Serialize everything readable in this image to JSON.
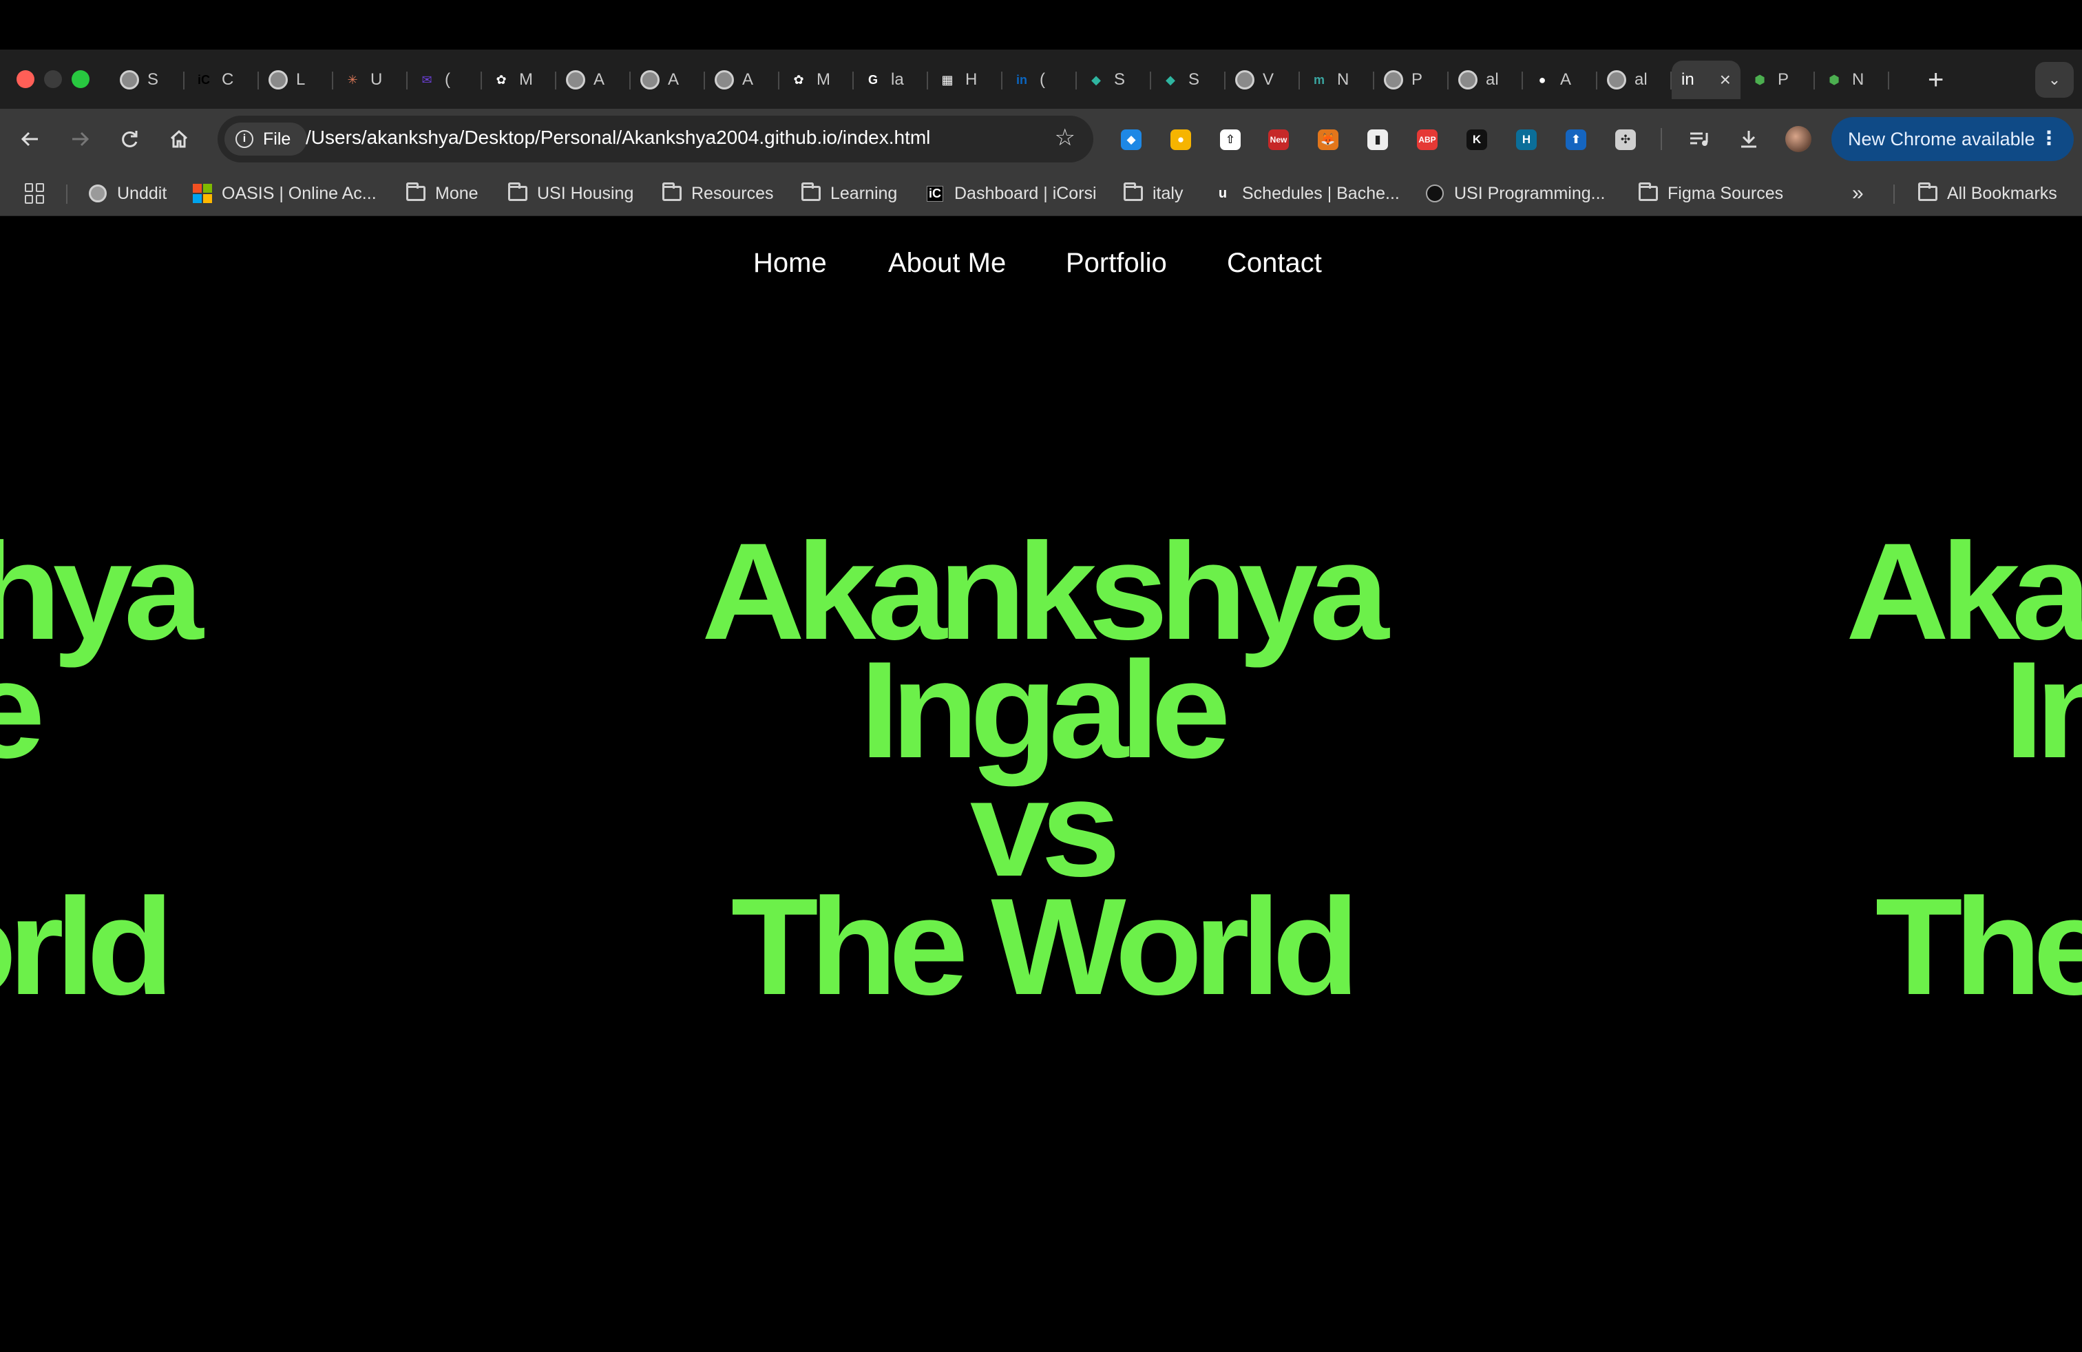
{
  "browser": {
    "tabs": [
      {
        "label": "S",
        "icon": "globe-icon",
        "color": "#888888",
        "glyph": ""
      },
      {
        "label": "C",
        "icon": "icorsi-icon",
        "color": "#000000",
        "glyph": "iC"
      },
      {
        "label": "L",
        "icon": "globe-icon",
        "color": "#888888",
        "glyph": ""
      },
      {
        "label": "U",
        "icon": "claude-icon",
        "color": "#d97757",
        "glyph": "✳"
      },
      {
        "label": "(",
        "icon": "mail-icon",
        "color": "#6b3fd6",
        "glyph": "✉"
      },
      {
        "label": "M",
        "icon": "chatgpt-icon",
        "color": "#ffffff",
        "glyph": "✿"
      },
      {
        "label": "A",
        "icon": "globe-icon",
        "color": "#888888",
        "glyph": ""
      },
      {
        "label": "A",
        "icon": "globe-icon",
        "color": "#888888",
        "glyph": ""
      },
      {
        "label": "A",
        "icon": "globe-icon",
        "color": "#888888",
        "glyph": ""
      },
      {
        "label": "M",
        "icon": "chatgpt-icon",
        "color": "#ffffff",
        "glyph": "✿"
      },
      {
        "label": "la",
        "icon": "google-icon",
        "color": "#ffffff",
        "glyph": "G"
      },
      {
        "label": "H",
        "icon": "notion-icon",
        "color": "#ffffff",
        "glyph": "▦"
      },
      {
        "label": "(",
        "icon": "linkedin-icon",
        "color": "#0a66c2",
        "glyph": "in"
      },
      {
        "label": "S",
        "icon": "diamond-icon",
        "color": "#2fb5a0",
        "glyph": "◆"
      },
      {
        "label": "S",
        "icon": "diamond-icon",
        "color": "#2fb5a0",
        "glyph": "◆"
      },
      {
        "label": "V",
        "icon": "globe-icon",
        "color": "#888888",
        "glyph": ""
      },
      {
        "label": "N",
        "icon": "m-icon",
        "color": "#3aa5a0",
        "glyph": "m"
      },
      {
        "label": "P",
        "icon": "globe-icon",
        "color": "#888888",
        "glyph": ""
      },
      {
        "label": "al",
        "icon": "globe-icon",
        "color": "#888888",
        "glyph": ""
      },
      {
        "label": "A",
        "icon": "github-icon",
        "color": "#ffffff",
        "glyph": "●"
      },
      {
        "label": "al",
        "icon": "globe-icon",
        "color": "#888888",
        "glyph": ""
      },
      {
        "label": "in",
        "icon": "",
        "color": "",
        "glyph": "",
        "active": true
      },
      {
        "label": "P",
        "icon": "cube-icon",
        "color": "#4caf50",
        "glyph": "⬢"
      },
      {
        "label": "N",
        "icon": "cube-icon",
        "color": "#4caf50",
        "glyph": "⬢"
      }
    ],
    "new_tab": "+",
    "tab_search": "⌄",
    "omnibox": {
      "chip_label": "File",
      "url": "/Users/akankshya/Desktop/Personal/Akankshya2004.github.io/index.html"
    },
    "extensions": [
      {
        "name": "gem-extension-icon",
        "color": "#1e88e5",
        "glyph": "◆"
      },
      {
        "name": "keep-extension-icon",
        "color": "#f6b400",
        "glyph": "●"
      },
      {
        "name": "upload-extension-icon",
        "color": "#ffffff",
        "glyph": "⇧"
      },
      {
        "name": "new-badge-extension-icon",
        "color": "#c62828",
        "glyph": "New"
      },
      {
        "name": "metamask-extension-icon",
        "color": "#e2761b",
        "glyph": "🦊"
      },
      {
        "name": "clipboard-extension-icon",
        "color": "#eeeeee",
        "glyph": "▮"
      },
      {
        "name": "adblock-extension-icon",
        "color": "#e53935",
        "glyph": "ABP"
      },
      {
        "name": "k-extension-icon",
        "color": "#111111",
        "glyph": "K"
      },
      {
        "name": "h-extension-icon",
        "color": "#0b6e99",
        "glyph": "H"
      },
      {
        "name": "box-extension-icon",
        "color": "#1565c0",
        "glyph": "⬆"
      },
      {
        "name": "puzzle-extensions-icon",
        "color": "#cfcfcf",
        "glyph": "✣"
      }
    ],
    "update_button": "New Chrome available",
    "bookmarks": [
      {
        "label": "Unddit",
        "type": "globe"
      },
      {
        "label": "OASIS | Online Ac...",
        "type": "microsoft"
      },
      {
        "label": "Mone",
        "type": "folder"
      },
      {
        "label": "USI Housing",
        "type": "folder"
      },
      {
        "label": "Resources",
        "type": "folder"
      },
      {
        "label": "Learning",
        "type": "folder"
      },
      {
        "label": "Dashboard | iCorsi",
        "type": "icorsi"
      },
      {
        "label": "italy",
        "type": "folder"
      },
      {
        "label": "Schedules | Bache...",
        "type": "usi"
      },
      {
        "label": "USI Programming...",
        "type": "github"
      },
      {
        "label": "Figma Sources",
        "type": "folder"
      }
    ],
    "bookmarks_overflow": "»",
    "all_bookmarks": "All Bookmarks"
  },
  "site": {
    "nav": [
      "Home",
      "About Me",
      "Portfolio",
      "Contact"
    ],
    "hero_lines": [
      "Akankshya",
      "Ingale",
      "vs",
      "The World"
    ],
    "accent_color": "#6cf04a"
  }
}
